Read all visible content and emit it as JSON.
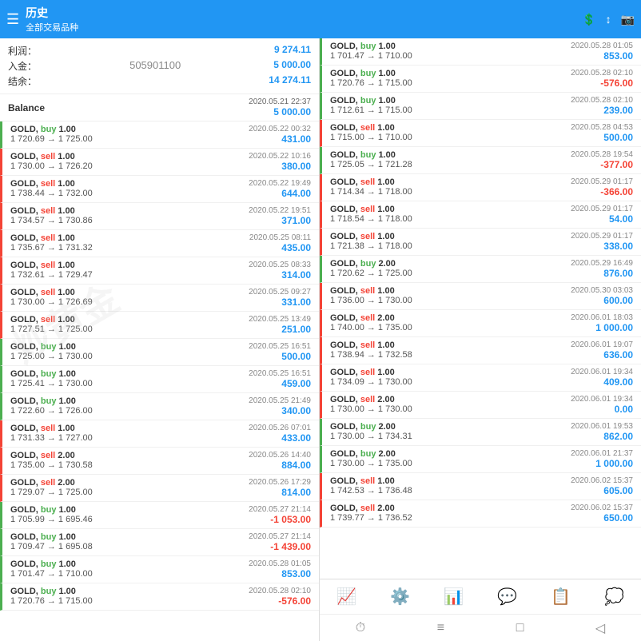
{
  "header": {
    "title": "历史",
    "subtitle": "全部交易品种"
  },
  "summary": {
    "profit_label": "利润：",
    "profit_value": "9 274.11",
    "deposit_label": "入金：",
    "deposit_value": "5 000.00",
    "balance_label": "结余：",
    "balance_value": "14 274.11",
    "phone": "505901100"
  },
  "balance_row": {
    "label": "Balance",
    "date": "2020.05.21 22:37",
    "amount": "5 000.00"
  },
  "left_trades": [
    {
      "type": "buy",
      "lot": "1.00",
      "from": "1 720.69",
      "to": "1 725.00",
      "date": "2020.05.22 00:32",
      "profit": "431.00",
      "profit_type": "positive"
    },
    {
      "type": "sell",
      "lot": "1.00",
      "from": "1 730.00",
      "to": "1 726.20",
      "date": "2020.05.22 10:16",
      "profit": "380.00",
      "profit_type": "positive"
    },
    {
      "type": "sell",
      "lot": "1.00",
      "from": "1 738.44",
      "to": "1 732.00",
      "date": "2020.05.22 19:49",
      "profit": "644.00",
      "profit_type": "positive"
    },
    {
      "type": "sell",
      "lot": "1.00",
      "from": "1 734.57",
      "to": "1 730.86",
      "date": "2020.05.22 19:51",
      "profit": "371.00",
      "profit_type": "positive"
    },
    {
      "type": "sell",
      "lot": "1.00",
      "from": "1 735.67",
      "to": "1 731.32",
      "date": "2020.05.25 08:11",
      "profit": "435.00",
      "profit_type": "positive"
    },
    {
      "type": "sell",
      "lot": "1.00",
      "from": "1 732.61",
      "to": "1 729.47",
      "date": "2020.05.25 08:33",
      "profit": "314.00",
      "profit_type": "positive"
    },
    {
      "type": "sell",
      "lot": "1.00",
      "from": "1 730.00",
      "to": "1 726.69",
      "date": "2020.05.25 09:27",
      "profit": "331.00",
      "profit_type": "positive"
    },
    {
      "type": "sell",
      "lot": "1.00",
      "from": "1 727.51",
      "to": "1 725.00",
      "date": "2020.05.25 13:49",
      "profit": "251.00",
      "profit_type": "positive"
    },
    {
      "type": "buy",
      "lot": "1.00",
      "from": "1 725.00",
      "to": "1 730.00",
      "date": "2020.05.25 16:51",
      "profit": "500.00",
      "profit_type": "positive"
    },
    {
      "type": "buy",
      "lot": "1.00",
      "from": "1 725.41",
      "to": "1 730.00",
      "date": "2020.05.25 16:51",
      "profit": "459.00",
      "profit_type": "positive"
    },
    {
      "type": "buy",
      "lot": "1.00",
      "from": "1 722.60",
      "to": "1 726.00",
      "date": "2020.05.25 21:49",
      "profit": "340.00",
      "profit_type": "positive"
    },
    {
      "type": "sell",
      "lot": "1.00",
      "from": "1 731.33",
      "to": "1 727.00",
      "date": "2020.05.26 07:01",
      "profit": "433.00",
      "profit_type": "positive"
    },
    {
      "type": "sell",
      "lot": "2.00",
      "from": "1 735.00",
      "to": "1 730.58",
      "date": "2020.05.26 14:40",
      "profit": "884.00",
      "profit_type": "positive"
    },
    {
      "type": "sell",
      "lot": "2.00",
      "from": "1 729.07",
      "to": "1 725.00",
      "date": "2020.05.26 17:29",
      "profit": "814.00",
      "profit_type": "positive"
    },
    {
      "type": "buy",
      "lot": "1.00",
      "from": "1 705.99",
      "to": "1 695.46",
      "date": "2020.05.27 21:14",
      "profit": "-1 053.00",
      "profit_type": "negative"
    },
    {
      "type": "buy",
      "lot": "1.00",
      "from": "1 709.47",
      "to": "1 695.08",
      "date": "2020.05.27 21:14",
      "profit": "-1 439.00",
      "profit_type": "negative"
    },
    {
      "type": "buy",
      "lot": "1.00",
      "from": "1 701.47",
      "to": "1 710.00",
      "date": "2020.05.28 01:05",
      "profit": "853.00",
      "profit_type": "positive"
    },
    {
      "type": "buy",
      "lot": "1.00",
      "from": "1 720.76",
      "to": "1 715.00",
      "date": "2020.05.28 02:10",
      "profit": "-576.00",
      "profit_type": "negative"
    }
  ],
  "right_trades": [
    {
      "type": "buy",
      "lot": "1.00",
      "from": "1 701.47",
      "to": "1 710.00",
      "date": "2020.05.28 01:05",
      "profit": "853.00",
      "profit_type": "positive"
    },
    {
      "type": "buy",
      "lot": "1.00",
      "from": "1 720.76",
      "to": "1 715.00",
      "date": "2020.05.28 02:10",
      "profit": "-576.00",
      "profit_type": "negative"
    },
    {
      "type": "buy",
      "lot": "1.00",
      "from": "1 712.61",
      "to": "1 715.00",
      "date": "2020.05.28 02:10",
      "profit": "239.00",
      "profit_type": "positive"
    },
    {
      "type": "sell",
      "lot": "1.00",
      "from": "1 715.00",
      "to": "1 710.00",
      "date": "2020.05.28 04:53",
      "profit": "500.00",
      "profit_type": "positive"
    },
    {
      "type": "buy",
      "lot": "1.00",
      "from": "1 725.05",
      "to": "1 721.28",
      "date": "2020.05.28 19:54",
      "profit": "-377.00",
      "profit_type": "negative"
    },
    {
      "type": "sell",
      "lot": "1.00",
      "from": "1 714.34",
      "to": "1 718.00",
      "date": "2020.05.29 01:17",
      "profit": "-366.00",
      "profit_type": "negative"
    },
    {
      "type": "sell",
      "lot": "1.00",
      "from": "1 718.54",
      "to": "1 718.00",
      "date": "2020.05.29 01:17",
      "profit": "54.00",
      "profit_type": "positive"
    },
    {
      "type": "sell",
      "lot": "1.00",
      "from": "1 721.38",
      "to": "1 718.00",
      "date": "2020.05.29 01:17",
      "profit": "338.00",
      "profit_type": "positive"
    },
    {
      "type": "buy",
      "lot": "2.00",
      "from": "1 720.62",
      "to": "1 725.00",
      "date": "2020.05.29 16:49",
      "profit": "876.00",
      "profit_type": "positive"
    },
    {
      "type": "sell",
      "lot": "1.00",
      "from": "1 736.00",
      "to": "1 730.00",
      "date": "2020.05.30 03:03",
      "profit": "600.00",
      "profit_type": "positive"
    },
    {
      "type": "sell",
      "lot": "2.00",
      "from": "1 740.00",
      "to": "1 735.00",
      "date": "2020.06.01 18:03",
      "profit": "1 000.00",
      "profit_type": "positive"
    },
    {
      "type": "sell",
      "lot": "1.00",
      "from": "1 738.94",
      "to": "1 732.58",
      "date": "2020.06.01 19:07",
      "profit": "636.00",
      "profit_type": "positive"
    },
    {
      "type": "sell",
      "lot": "1.00",
      "from": "1 734.09",
      "to": "1 730.00",
      "date": "2020.06.01 19:34",
      "profit": "409.00",
      "profit_type": "positive"
    },
    {
      "type": "sell",
      "lot": "2.00",
      "from": "1 730.00",
      "to": "1 730.00",
      "date": "2020.06.01 19:34",
      "profit": "0.00",
      "profit_type": "positive"
    },
    {
      "type": "buy",
      "lot": "2.00",
      "from": "1 730.00",
      "to": "1 734.31",
      "date": "2020.06.01 19:53",
      "profit": "862.00",
      "profit_type": "positive"
    },
    {
      "type": "buy",
      "lot": "2.00",
      "from": "1 730.00",
      "to": "1 735.00",
      "date": "2020.06.01 21:37",
      "profit": "1 000.00",
      "profit_type": "positive"
    },
    {
      "type": "sell",
      "lot": "1.00",
      "from": "1 742.53",
      "to": "1 736.48",
      "date": "2020.06.02 15:37",
      "profit": "605.00",
      "profit_type": "positive"
    },
    {
      "type": "sell",
      "lot": "2.00",
      "from": "1 739.77",
      "to": "1 736.52",
      "date": "2020.06.02 15:37",
      "profit": "650.00",
      "profit_type": "positive"
    }
  ],
  "bottom_nav": {
    "icons": [
      "📈",
      "⚙️",
      "📊",
      "💬",
      "📋",
      "💭"
    ]
  },
  "sub_nav": {
    "icons": [
      "⏱",
      "≡",
      "□",
      "◁"
    ]
  }
}
